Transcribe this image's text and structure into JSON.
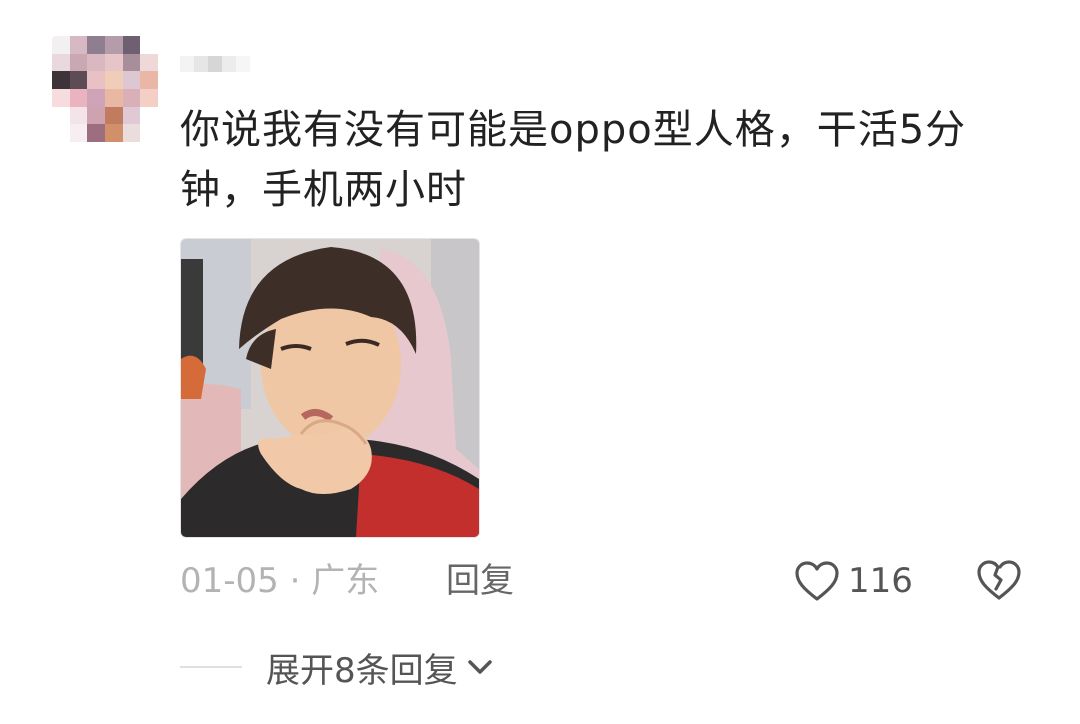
{
  "comment": {
    "text": "你说我有没有可能是oppo型人格，干活5分钟，手机两小时",
    "date_location": "01-05 · 广东",
    "reply_label": "回复",
    "like_count": "116",
    "expand_label": "展开8条回复"
  },
  "icons": {
    "like": "heart-outline-icon",
    "dislike": "broken-heart-icon",
    "expand": "chevron-down-icon"
  },
  "colors": {
    "text_primary": "#222222",
    "text_secondary": "#b3b3b3",
    "action": "#555555"
  }
}
